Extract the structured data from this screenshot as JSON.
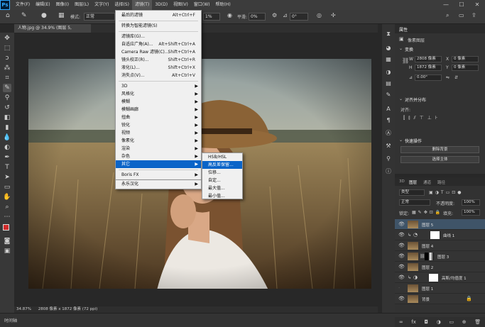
{
  "app": {
    "logo": "Ps"
  },
  "menubar": [
    "文件(F)",
    "编辑(E)",
    "图像(I)",
    "图层(L)",
    "文字(Y)",
    "选择(S)",
    "滤镜(T)",
    "3D(D)",
    "视图(V)",
    "窗口(W)",
    "帮助(H)"
  ],
  "window_controls": [
    "—",
    "☐",
    "✕"
  ],
  "options": {
    "mode_label": "模式:",
    "mode_value": "正常",
    "opacity_value": "1%",
    "flow_label": "平滑:",
    "flow_value": "0%",
    "angle_value": "0°"
  },
  "document_tab": "人物.jpg @ 34.9% (图层 5, RGB/8#) *",
  "status": {
    "zoom": "34.87%",
    "size": "2808 像素 x 1872 像素 (72 ppi)"
  },
  "timeline": "时间轴",
  "filter_menu": {
    "group1": [
      {
        "label": "最后的滤镜",
        "shortcut": "Alt+Ctrl+F"
      }
    ],
    "group2": [
      {
        "label": "转换为智能滤镜(S)",
        "shortcut": ""
      }
    ],
    "group3": [
      {
        "label": "滤镜库(G)...",
        "shortcut": ""
      },
      {
        "label": "自适应广角(A)...",
        "shortcut": "Alt+Shift+Ctrl+A"
      },
      {
        "label": "Camera Raw 滤镜(C)...",
        "shortcut": "Shift+Ctrl+A"
      },
      {
        "label": "镜头校正(R)...",
        "shortcut": "Shift+Ctrl+R"
      },
      {
        "label": "液化(L)...",
        "shortcut": "Shift+Ctrl+X"
      },
      {
        "label": "消失点(V)...",
        "shortcut": "Alt+Ctrl+V"
      }
    ],
    "group4": [
      "3D",
      "风格化",
      "模糊",
      "模糊画廊",
      "扭曲",
      "锐化",
      "视频",
      "像素化",
      "渲染",
      "杂色",
      "其它"
    ],
    "group5": [
      "Boris FX",
      "永乐汉化"
    ],
    "highlighted": "其它"
  },
  "submenu": {
    "items": [
      "HSB/HSL",
      "高反差保留...",
      "位移...",
      "自定...",
      "最大值...",
      "最小值..."
    ],
    "highlighted": "高反差保留..."
  },
  "properties": {
    "title": "属性",
    "subtitle": "像素图层",
    "transform_label": "变换",
    "w_label": "W",
    "w_value": "2808 像素",
    "x_label": "X",
    "x_value": "0 像素",
    "h_label": "H",
    "h_value": "1872 像素",
    "y_label": "Y",
    "y_value": "0 像素",
    "angle_value": "0.00°",
    "align_label": "对齐并分布",
    "align_sub": "对齐:",
    "quick_label": "快速操作",
    "btn_remove_bg": "删除背景",
    "btn_select_subject": "选择主体"
  },
  "layers_panel": {
    "tabs": [
      "3D",
      "图层",
      "通道",
      "路径"
    ],
    "kind": "类型",
    "blend": "正常",
    "opacity_label": "不透明度:",
    "opacity_value": "100%",
    "lock_label": "锁定:",
    "fill_label": "填充:",
    "fill_value": "100%",
    "rows": [
      {
        "name": "图层 5",
        "selected": true,
        "mask": false
      },
      {
        "name": "曲线 1",
        "selected": false,
        "mask": true
      },
      {
        "name": "图层 4",
        "selected": false,
        "mask": false
      },
      {
        "name": "图层 3",
        "selected": false,
        "mask": true
      },
      {
        "name": "图层 2",
        "selected": false,
        "mask": false
      },
      {
        "name": "高斯/均值度 1",
        "selected": false,
        "mask": true
      },
      {
        "name": "图层 1",
        "selected": false,
        "mask": false
      },
      {
        "name": "背景",
        "selected": false,
        "mask": false
      }
    ]
  },
  "layer_bottom_icons": [
    "∞",
    "fx",
    "◘",
    "◑",
    "▭",
    "⊕",
    "🗑"
  ]
}
